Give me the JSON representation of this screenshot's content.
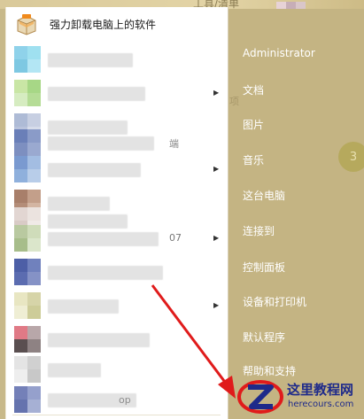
{
  "programs": {
    "first": {
      "label": "强力卸载电脑上的软件",
      "icon": "package-icon"
    },
    "blurred_items": 12
  },
  "right_menu": {
    "user": "Administrator",
    "items": [
      {
        "label": "文档"
      },
      {
        "label": "图片"
      },
      {
        "label": "音乐"
      },
      {
        "label": "这台电脑"
      },
      {
        "label": "连接到"
      },
      {
        "label": "控制面板"
      },
      {
        "label": "设备和打印机"
      },
      {
        "label": "默认程序"
      },
      {
        "label": "帮助和支持"
      }
    ]
  },
  "desktop": {
    "ghost_title": "工具/清单",
    "badge": "3",
    "ghost_b": "项",
    "ghost_c": "端",
    "ghost_d": "07",
    "ghost_e": "op"
  },
  "watermark": {
    "title": "这里教程网",
    "url": "herecours.com"
  },
  "colors": {
    "accent_red": "#e01b1b",
    "watermark_blue": "#1e2a8a",
    "menu_bg": "#c4b483"
  }
}
